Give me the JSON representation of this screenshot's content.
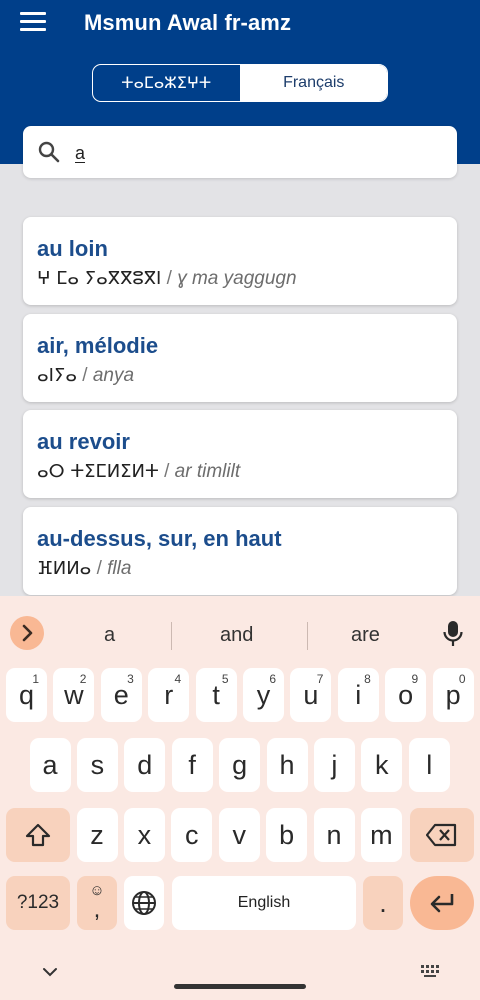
{
  "header": {
    "title": "Msmun Awal fr-amz",
    "lang_tifinagh": "ⵜⴰⵎⴰⵣⵉⵖⵜ",
    "lang_french": "Français"
  },
  "search": {
    "value": "a"
  },
  "results": [
    {
      "title": "au loin",
      "tifinagh": "ⵖ ⵎⴰ ⵢⴰⴳⴳⵓⴳⵏ",
      "latin": "ɣ ma yaggugn"
    },
    {
      "title": "air, mélodie",
      "tifinagh": "ⴰⵏⵢⴰ",
      "latin": "anya"
    },
    {
      "title": "au revoir",
      "tifinagh": "ⴰⵔ ⵜⵉⵎⵍⵉⵍⵜ",
      "latin": "ar timlilt"
    },
    {
      "title": "au-dessus, sur, en haut",
      "tifinagh": "ⴼⵍⵍⴰ",
      "latin": "flla"
    }
  ],
  "keyboard": {
    "suggestions": [
      "a",
      "and",
      "are"
    ],
    "row1": [
      {
        "k": "q",
        "n": "1"
      },
      {
        "k": "w",
        "n": "2"
      },
      {
        "k": "e",
        "n": "3"
      },
      {
        "k": "r",
        "n": "4"
      },
      {
        "k": "t",
        "n": "5"
      },
      {
        "k": "y",
        "n": "6"
      },
      {
        "k": "u",
        "n": "7"
      },
      {
        "k": "i",
        "n": "8"
      },
      {
        "k": "o",
        "n": "9"
      },
      {
        "k": "p",
        "n": "0"
      }
    ],
    "row2": [
      "a",
      "s",
      "d",
      "f",
      "g",
      "h",
      "j",
      "k",
      "l"
    ],
    "row3": [
      "z",
      "x",
      "c",
      "v",
      "b",
      "n",
      "m"
    ],
    "symbols_label": "?123",
    "comma_label": ",",
    "space_label": "English",
    "period_label": "."
  },
  "colors": {
    "header_bg": "#003f8a",
    "title_blue": "#1c4d8c",
    "keyboard_bg": "#fbe9e3",
    "accent": "#f9b894"
  }
}
